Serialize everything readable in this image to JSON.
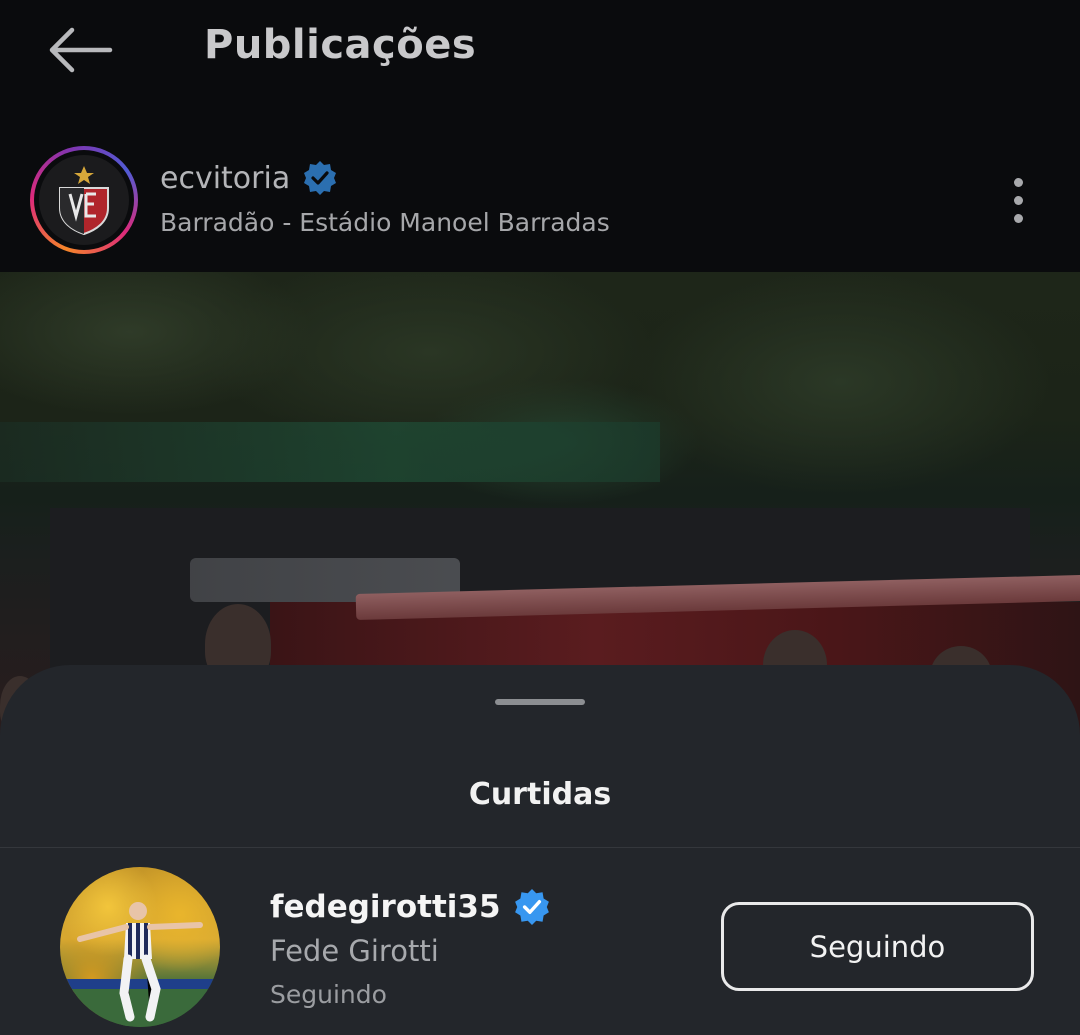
{
  "header": {
    "title": "Publicações",
    "back_icon": "arrow-left-icon"
  },
  "post": {
    "username": "ecvitoria",
    "verified": true,
    "location": "Barradão - Estádio Manoel Barradas",
    "more_icon": "more-vertical-icon"
  },
  "likes_sheet": {
    "title": "Curtidas",
    "users": [
      {
        "username": "fedegirotti35",
        "verified": true,
        "full_name": "Fede Girotti",
        "status": "Seguindo",
        "button_label": "Seguindo"
      }
    ]
  },
  "colors": {
    "background": "#0a0b0d",
    "sheet": "#23262b",
    "verified_badge": "#3897f0"
  }
}
